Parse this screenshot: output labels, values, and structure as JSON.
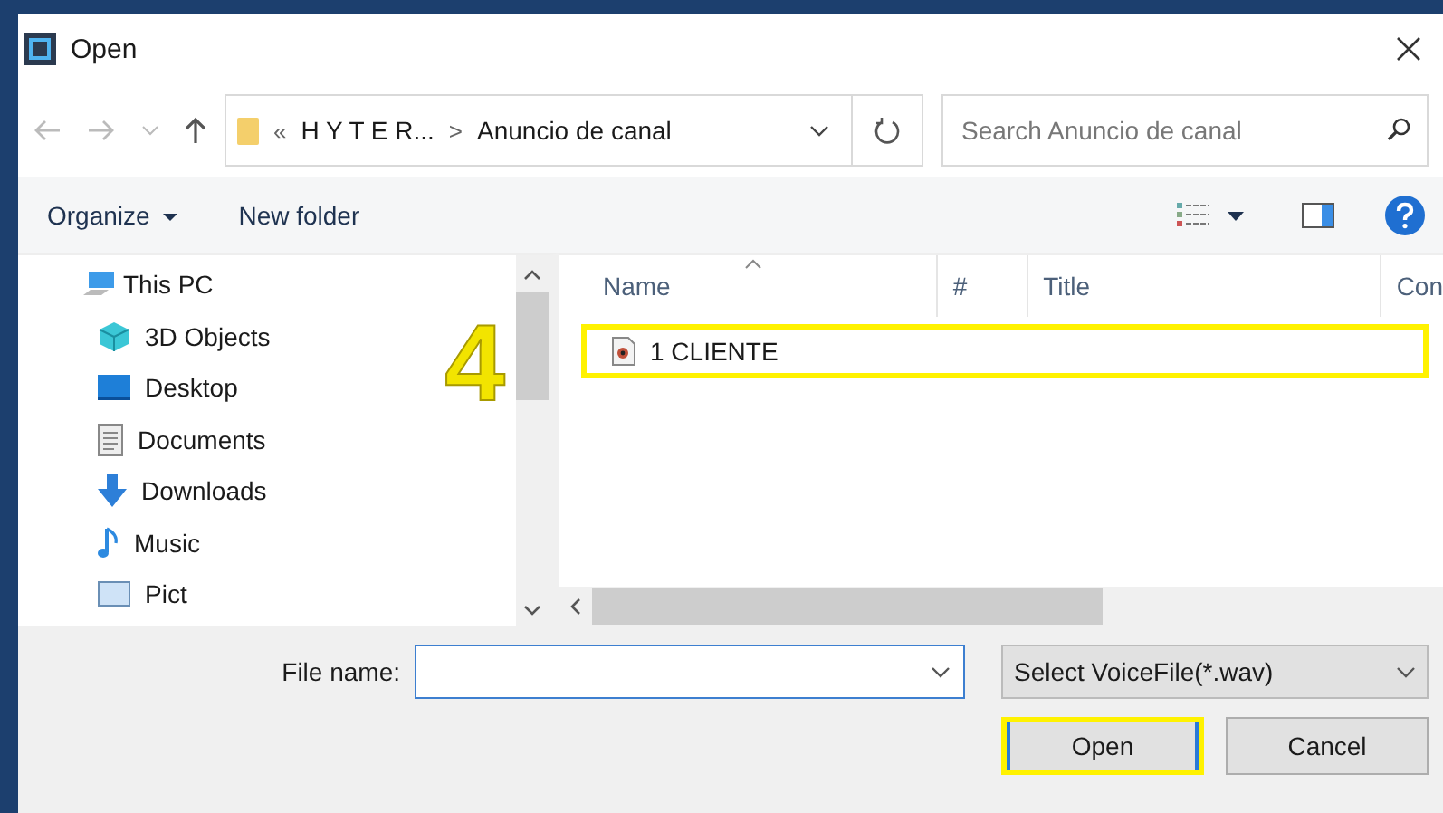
{
  "window": {
    "title": "Open"
  },
  "nav": {
    "breadcrumb": [
      "«",
      "H Y T E R...",
      ">",
      "Anuncio de canal"
    ],
    "search": {
      "placeholder": "Search Anuncio de canal"
    }
  },
  "toolbar": {
    "organize": "Organize",
    "new_folder": "New folder"
  },
  "sidebar": {
    "items": [
      {
        "label": "This PC",
        "children": [
          {
            "label": "3D Objects"
          },
          {
            "label": "Desktop"
          },
          {
            "label": "Documents"
          },
          {
            "label": "Downloads"
          },
          {
            "label": "Music"
          },
          {
            "label": "Pict"
          }
        ]
      }
    ]
  },
  "annotation": {
    "label": "4"
  },
  "table": {
    "columns": [
      "Name",
      "#",
      "Title",
      "Con"
    ],
    "rows": [
      {
        "name": "1 CLIENTE",
        "highlighted": true
      }
    ]
  },
  "footer": {
    "file_name_label": "File name:",
    "file_type": "Select VoiceFile(*.wav)",
    "buttons": [
      {
        "label": "Open",
        "highlighted": true
      },
      {
        "label": "Cancel",
        "highlighted": false
      }
    ]
  }
}
